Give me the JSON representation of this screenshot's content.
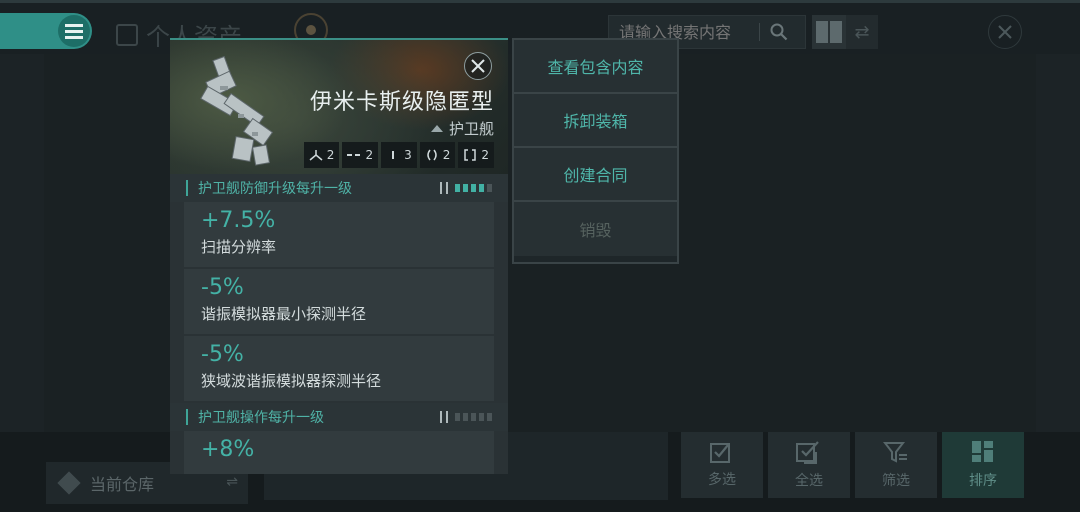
{
  "header": {
    "title": "个人资产",
    "search_placeholder": "请输入搜索内容"
  },
  "bottom": {
    "warehouse_label": "当前仓库",
    "actions": [
      {
        "label": "多选",
        "icon": "checkbox-icon"
      },
      {
        "label": "全选",
        "icon": "check-all-icon"
      },
      {
        "label": "筛选",
        "icon": "filter-icon"
      },
      {
        "label": "排序",
        "icon": "sort-grid-icon"
      }
    ]
  },
  "ship": {
    "name": "伊米卡斯级隐匿型",
    "class": "护卫舰",
    "slots": [
      {
        "icon": "high-slot-icon",
        "value": "2"
      },
      {
        "icon": "mid-slot-icon",
        "value": "2"
      },
      {
        "icon": "low-slot-icon",
        "value": "3"
      },
      {
        "icon": "rig-slot-icon",
        "value": "2"
      },
      {
        "icon": "subsystem-slot-icon",
        "value": "2"
      }
    ]
  },
  "sections": [
    {
      "title": "护卫舰防御升级每升一级",
      "level": 4,
      "level_max": 5,
      "bonuses": [
        {
          "value": "+7.5%",
          "desc": "扫描分辨率"
        },
        {
          "value": "-5%",
          "desc": "谐振模拟器最小探测半径"
        },
        {
          "value": "-5%",
          "desc": "狭域波谐振模拟器探测半径"
        }
      ]
    },
    {
      "title": "护卫舰操作每升一级",
      "level": 0,
      "level_max": 5,
      "bonuses": [
        {
          "value": "+8%",
          "desc": ""
        }
      ]
    }
  ],
  "context_menu": {
    "items": [
      {
        "label": "查看包含内容",
        "enabled": true
      },
      {
        "label": "拆卸装箱",
        "enabled": true
      },
      {
        "label": "创建合同",
        "enabled": true
      },
      {
        "label": "销毁",
        "enabled": false
      }
    ]
  },
  "colors": {
    "accent": "#3fa598",
    "accent_text": "#4fb6aa",
    "panel_bg": "#2a3235",
    "background": "#1c2326"
  }
}
